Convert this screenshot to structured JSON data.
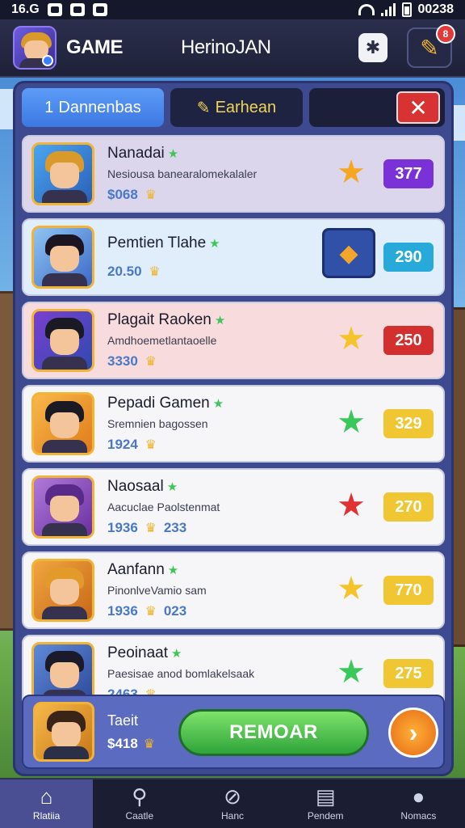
{
  "statusbar": {
    "time": "16.G",
    "clock": "00238"
  },
  "header": {
    "title": "GAME",
    "subtitle": "HerinoJAN",
    "notification_count": "8"
  },
  "tabs": [
    {
      "label": "Dannenbas",
      "icon": "1"
    },
    {
      "label": "Earhean",
      "icon": "✎"
    }
  ],
  "rows": [
    {
      "name": "Nanadai",
      "sub": "Nesiousa banearalomekalaler",
      "stats": "$068",
      "score": "377",
      "score_color": "#7a32d8",
      "bg": "#dcd6ec",
      "action": "star",
      "action_color": "#f5a623"
    },
    {
      "name": "Pemtien Tlahe",
      "sub": "",
      "stats": "20.50",
      "score": "290",
      "score_color": "#27a9d9",
      "bg": "#dfeefa",
      "action": "boxed"
    },
    {
      "name": "Plagait Raoken",
      "sub": "Amdhoemetlantaoelle",
      "stats": "3330",
      "score": "250",
      "score_color": "#d42f2f",
      "bg": "#f8dbdc",
      "action": "star",
      "action_color": "#f5c32a"
    },
    {
      "name": "Pepadi Gamen",
      "sub": "Sremnien bagossen",
      "stats": "1924",
      "score": "329",
      "score_color": "#f0c733",
      "bg": "#f6f6f8",
      "action": "star",
      "action_color": "#3ac85a"
    },
    {
      "name": "Naosaal",
      "sub": "Aacuclae Paolstenmat",
      "stats": "1936",
      "stats2": "233",
      "score": "270",
      "score_color": "#f0c733",
      "bg": "#f6f6f8",
      "action": "star",
      "action_color": "#e03232"
    },
    {
      "name": "Aanfann",
      "sub": "PinonlveVamio sam",
      "stats": "1936",
      "stats2": "023",
      "score": "770",
      "score_color": "#f0c733",
      "bg": "#f6f6f8",
      "action": "star",
      "action_color": "#f5c32a"
    },
    {
      "name": "Peoinaat",
      "sub": "Paesisae anod bomlakelsaak",
      "stats": "2463",
      "score": "275",
      "score_color": "#f0c733",
      "bg": "#f6f6f8",
      "action": "star",
      "action_color": "#3ac85a"
    }
  ],
  "footer": {
    "name": "Taeit",
    "value": "$418",
    "cta_label": "REMOAR"
  },
  "nav": [
    {
      "label": "Rlatiia",
      "icon": "⌂"
    },
    {
      "label": "Caatle",
      "icon": "⚲"
    },
    {
      "label": "Hanc",
      "icon": "⊘"
    },
    {
      "label": "Pendem",
      "icon": "▤"
    },
    {
      "label": "Nomacs",
      "icon": "●"
    }
  ]
}
